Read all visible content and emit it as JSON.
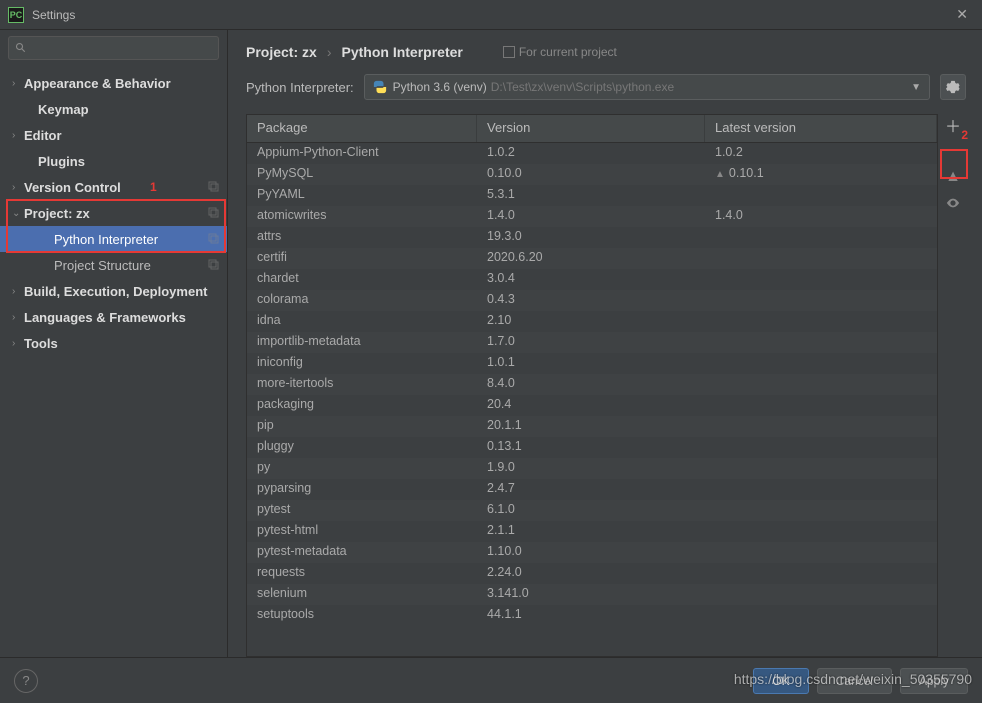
{
  "window": {
    "title": "Settings"
  },
  "search": {
    "placeholder": ""
  },
  "sidebar": {
    "items": [
      {
        "label": "Appearance & Behavior",
        "expandable": true,
        "bold": true,
        "indent": 0
      },
      {
        "label": "Keymap",
        "expandable": false,
        "bold": true,
        "indent": 1
      },
      {
        "label": "Editor",
        "expandable": true,
        "bold": true,
        "indent": 0
      },
      {
        "label": "Plugins",
        "expandable": false,
        "bold": true,
        "indent": 1
      },
      {
        "label": "Version Control",
        "expandable": true,
        "bold": true,
        "indent": 0,
        "copy": true
      },
      {
        "label": "Project: zx",
        "expandable": true,
        "expanded": true,
        "bold": true,
        "indent": 0,
        "copy": true
      },
      {
        "label": "Python Interpreter",
        "expandable": false,
        "bold": false,
        "indent": 2,
        "selected": true,
        "copy": true
      },
      {
        "label": "Project Structure",
        "expandable": false,
        "bold": false,
        "indent": 2,
        "copy": true
      },
      {
        "label": "Build, Execution, Deployment",
        "expandable": true,
        "bold": true,
        "indent": 0
      },
      {
        "label": "Languages & Frameworks",
        "expandable": true,
        "bold": true,
        "indent": 0
      },
      {
        "label": "Tools",
        "expandable": true,
        "bold": true,
        "indent": 0
      }
    ]
  },
  "annotations": {
    "one": "1",
    "two": "2"
  },
  "breadcrumb": {
    "part1": "Project: zx",
    "part2": "Python Interpreter",
    "for_project": "For current project"
  },
  "interpreter": {
    "label": "Python Interpreter:",
    "name": "Python 3.6 (venv)",
    "path": "D:\\Test\\zx\\venv\\Scripts\\python.exe"
  },
  "columns": {
    "package": "Package",
    "version": "Version",
    "latest": "Latest version"
  },
  "packages": [
    {
      "name": "Appium-Python-Client",
      "version": "1.0.2",
      "latest": "1.0.2"
    },
    {
      "name": "PyMySQL",
      "version": "0.10.0",
      "latest": "0.10.1",
      "upgrade": true
    },
    {
      "name": "PyYAML",
      "version": "5.3.1",
      "latest": ""
    },
    {
      "name": "atomicwrites",
      "version": "1.4.0",
      "latest": "1.4.0"
    },
    {
      "name": "attrs",
      "version": "19.3.0",
      "latest": ""
    },
    {
      "name": "certifi",
      "version": "2020.6.20",
      "latest": ""
    },
    {
      "name": "chardet",
      "version": "3.0.4",
      "latest": ""
    },
    {
      "name": "colorama",
      "version": "0.4.3",
      "latest": ""
    },
    {
      "name": "idna",
      "version": "2.10",
      "latest": ""
    },
    {
      "name": "importlib-metadata",
      "version": "1.7.0",
      "latest": ""
    },
    {
      "name": "iniconfig",
      "version": "1.0.1",
      "latest": ""
    },
    {
      "name": "more-itertools",
      "version": "8.4.0",
      "latest": ""
    },
    {
      "name": "packaging",
      "version": "20.4",
      "latest": ""
    },
    {
      "name": "pip",
      "version": "20.1.1",
      "latest": ""
    },
    {
      "name": "pluggy",
      "version": "0.13.1",
      "latest": ""
    },
    {
      "name": "py",
      "version": "1.9.0",
      "latest": ""
    },
    {
      "name": "pyparsing",
      "version": "2.4.7",
      "latest": ""
    },
    {
      "name": "pytest",
      "version": "6.1.0",
      "latest": ""
    },
    {
      "name": "pytest-html",
      "version": "2.1.1",
      "latest": ""
    },
    {
      "name": "pytest-metadata",
      "version": "1.10.0",
      "latest": ""
    },
    {
      "name": "requests",
      "version": "2.24.0",
      "latest": ""
    },
    {
      "name": "selenium",
      "version": "3.141.0",
      "latest": ""
    },
    {
      "name": "setuptools",
      "version": "44.1.1",
      "latest": ""
    }
  ],
  "footer": {
    "ok": "OK",
    "cancel": "Cancel",
    "apply": "Apply"
  },
  "watermark": "https://blog.csdn.net/weixin_50355790"
}
